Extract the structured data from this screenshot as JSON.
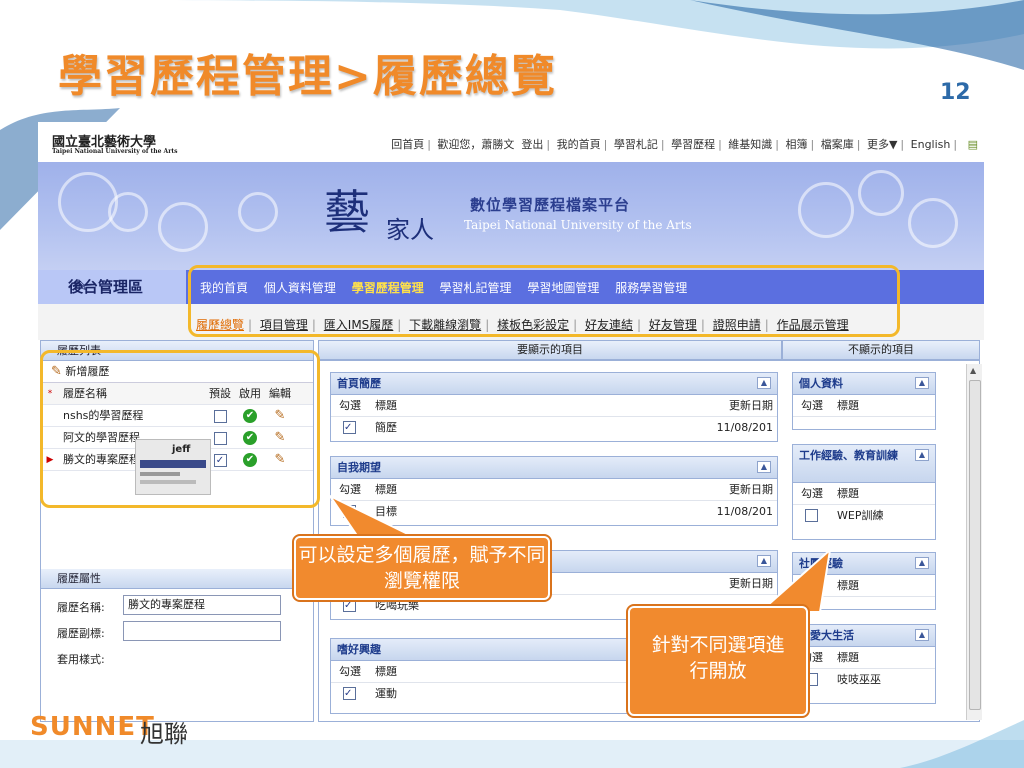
{
  "slide": {
    "title": "學習歷程管理>履歷總覽",
    "page_number": "12",
    "footer_brand": "SUNNET",
    "footer_brand_zh": "旭聯"
  },
  "site": {
    "univ_name": "國立臺北藝術大學",
    "univ_name_en": "Taipei National University of the Arts",
    "top_links": [
      "回首頁",
      "歡迎您，蕭勝文",
      "登出",
      "我的首頁",
      "學習札記",
      "學習歷程",
      "維基知識",
      "相簿",
      "檔案庫",
      "更多▼",
      "English"
    ],
    "platform_zh": "數位學習歷程檔案平台",
    "platform_en": "Taipei National University of the Arts",
    "logo_char_1": "藝",
    "logo_char_2": "家人"
  },
  "nav": {
    "admin_label": "後台管理區",
    "items": [
      "我的首頁",
      "個人資料管理",
      "學習歷程管理",
      "學習札記管理",
      "學習地圖管理",
      "服務學習管理"
    ],
    "active": "學習歷程管理"
  },
  "subnav": {
    "items": [
      "履歷總覽",
      "項目管理",
      "匯入IMS履歷",
      "下載離線瀏覽",
      "樣板色彩設定",
      "好友連結",
      "好友管理",
      "證照申請",
      "作品展示管理"
    ],
    "active": "履歷總覽"
  },
  "resume_list": {
    "title": "履歷列表",
    "add_label": "新增履歷",
    "columns": [
      "履歷名稱",
      "預設",
      "啟用",
      "編輯"
    ],
    "rows": [
      {
        "name": "nshs的學習歷程",
        "default": false,
        "enabled": true,
        "selected": false
      },
      {
        "name": "阿文的學習歷程",
        "default": false,
        "enabled": true,
        "selected": false
      },
      {
        "name": "勝文的專案歷程",
        "default": true,
        "enabled": true,
        "selected": true
      }
    ]
  },
  "resume_props": {
    "title": "履歷屬性",
    "name_label": "履歷名稱:",
    "name_value": "勝文的專案歷程",
    "subtitle_label": "履歷副標:",
    "subtitle_value": "",
    "style_label": "套用樣式:",
    "thumb_text": "jeff"
  },
  "display": {
    "shown_header": "要顯示的項目",
    "hidden_header": "不顯示的項目",
    "col_check": "勾選",
    "col_title": "標題",
    "col_date": "更新日期",
    "shown_sections": [
      {
        "title": "首頁簡歷",
        "rows": [
          {
            "title": "簡歷",
            "date": "11/08/201",
            "checked": true
          }
        ]
      },
      {
        "title": "自我期望",
        "rows": [
          {
            "title": "目標",
            "date": "11/08/201",
            "checked": false
          }
        ]
      },
      {
        "title": "",
        "rows": [
          {
            "title": "吃喝玩樂",
            "date": "",
            "checked": true
          }
        ]
      },
      {
        "title": "嗜好興趣",
        "rows": [
          {
            "title": "運動",
            "date": "",
            "checked": true
          }
        ]
      }
    ],
    "hidden_sections": [
      {
        "title": "個人資料",
        "rows": []
      },
      {
        "title": "工作經驗、教育訓練",
        "rows": [
          {
            "title": "WEP訓練",
            "checked": false
          }
        ]
      },
      {
        "title": "社團經驗",
        "rows": []
      },
      {
        "title": "我愛大生活",
        "rows": [
          {
            "title": "吱吱巫巫",
            "checked": false
          }
        ]
      }
    ]
  },
  "callouts": {
    "left": "可以設定多個履歷，賦予不同瀏覽權限",
    "right": "針對不同選項進行開放"
  },
  "colors": {
    "title_orange": "#f08a2a",
    "nav_blue": "#5b6fe0",
    "highlight": "#f3b82a",
    "callout": "#f18a2e"
  }
}
